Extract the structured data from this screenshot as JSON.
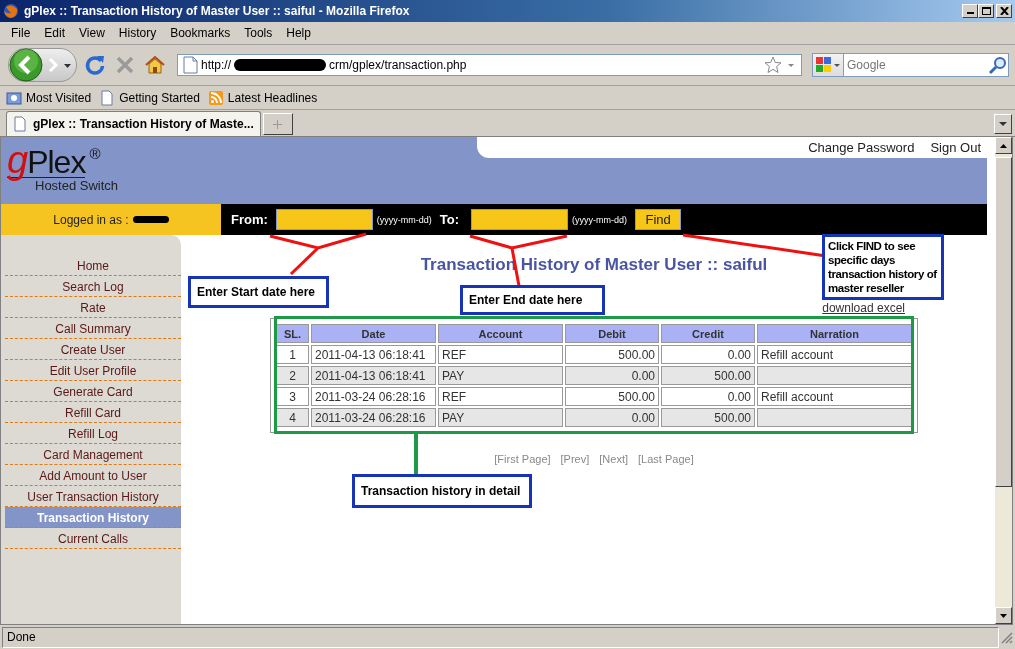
{
  "window": {
    "title": "gPlex :: Transaction History of Master User :: saiful - Mozilla Firefox"
  },
  "menu": [
    "File",
    "Edit",
    "View",
    "History",
    "Bookmarks",
    "Tools",
    "Help"
  ],
  "toolbar": {
    "url_prefix": "http://",
    "url_path": "crm/gplex/transaction.php",
    "search_placeholder": "Google"
  },
  "bookmarks": [
    {
      "label": "Most Visited",
      "kind": "folder"
    },
    {
      "label": "Getting Started",
      "kind": "page"
    },
    {
      "label": "Latest Headlines",
      "kind": "feed"
    }
  ],
  "tabs": [
    {
      "label": "gPlex :: Transaction History of Maste...",
      "selected": true
    }
  ],
  "page": {
    "logo": {
      "brand": "gPlex",
      "mark": "®",
      "tagline": "Hosted Switch"
    },
    "header_links": [
      "Change Password",
      "Sign Out"
    ],
    "login_label": "Logged in as :",
    "filter": {
      "from_label": "From:",
      "from_hint": "(yyyy-mm-dd)",
      "to_label": "To:",
      "to_hint": "(yyyy-mm-dd)",
      "button": "Find"
    },
    "sidebar": {
      "items": [
        {
          "label": "Home",
          "selected": false
        },
        {
          "label": "Search Log",
          "selected": false
        },
        {
          "label": "Rate",
          "selected": false
        },
        {
          "label": "Call Summary",
          "selected": false
        },
        {
          "label": "Create User",
          "selected": false
        },
        {
          "label": "Edit User Profile",
          "selected": false
        },
        {
          "label": "Generate Card",
          "selected": false
        },
        {
          "label": "Refill Card",
          "selected": false
        },
        {
          "label": "Refill Log",
          "selected": false
        },
        {
          "label": "Card Management",
          "selected": false
        },
        {
          "label": "Add Amount to User",
          "selected": false
        },
        {
          "label": "User Transaction History",
          "selected": false
        },
        {
          "label": "Transaction History",
          "selected": true
        },
        {
          "label": "Current Calls",
          "selected": false
        }
      ]
    },
    "title": "Transaction History of Master User :: saiful",
    "download_link": "download excel",
    "table": {
      "columns": [
        "SL.",
        "Date",
        "Account",
        "Debit",
        "Credit",
        "Narration"
      ],
      "rows": [
        {
          "sl": "1",
          "date": "2011-04-13 06:18:41",
          "account": "REF",
          "debit": "500.00",
          "credit": "0.00",
          "narration": "Refill account"
        },
        {
          "sl": "2",
          "date": "2011-04-13 06:18:41",
          "account": "PAY",
          "debit": "0.00",
          "credit": "500.00"
        },
        {
          "sl": "3",
          "date": "2011-03-24 06:28:16",
          "account": "REF",
          "debit": "500.00",
          "credit": "0.00",
          "narration": "Refill account"
        },
        {
          "sl": "4",
          "date": "2011-03-24 06:28:16",
          "account": "PAY",
          "debit": "0.00",
          "credit": "500.00"
        }
      ]
    },
    "pagination": [
      "[First Page]",
      "[Prev]",
      "[Next]",
      "[Last Page]"
    ]
  },
  "annotations": [
    {
      "kind": "callout",
      "text": "Enter Start date here"
    },
    {
      "kind": "callout",
      "text": "Enter End date here"
    },
    {
      "kind": "callout",
      "text": "Click FIND to see specific days transaction history of master reseller"
    },
    {
      "kind": "callout",
      "text": "Transaction history in detail"
    }
  ],
  "status_bar": "Done"
}
